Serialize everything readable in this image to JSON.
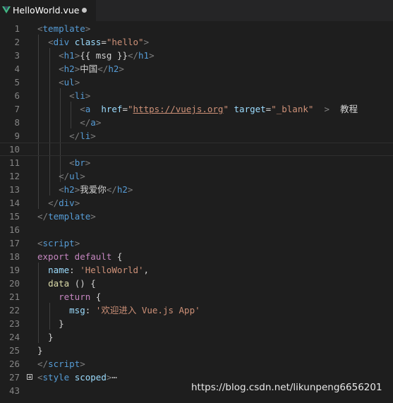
{
  "tab": {
    "title": "HelloWorld.vue",
    "unsaved": true
  },
  "line_numbers": [
    "1",
    "2",
    "3",
    "4",
    "5",
    "6",
    "7",
    "8",
    "9",
    "10",
    "11",
    "12",
    "13",
    "14",
    "15",
    "16",
    "17",
    "18",
    "19",
    "20",
    "21",
    "22",
    "23",
    "24",
    "25",
    "26",
    "27",
    "43"
  ],
  "code": {
    "l1_tag": "template",
    "l2_tag": "div",
    "l2_attr": "class",
    "l2_val": "\"hello\"",
    "l3_tag": "h1",
    "l3_text": "{{ msg }}",
    "l4_tag": "h2",
    "l4_text": "中国",
    "l5_tag": "ul",
    "l6_tag": "li",
    "l7_tag": "a",
    "l7_attr1": "href",
    "l7_val1": "https://vuejs.org",
    "l7_attr2": "target",
    "l7_val2": "\"_blank\"",
    "l7_text": "教程",
    "l8_tag": "a",
    "l9_tag": "li",
    "l11_tag": "br",
    "l12_tag": "ul",
    "l13_tag": "h2",
    "l13_text": "我爱你",
    "l14_tag": "div",
    "l15_tag": "template",
    "l17_tag": "script",
    "l18_kw": "export default",
    "l19_prop": "name",
    "l19_val": "'HelloWorld'",
    "l20_fn": "data",
    "l21_kw": "return",
    "l22_prop": "msg",
    "l22_val": "'欢迎进入 Vue.js App'",
    "l26_tag": "script",
    "l27_tag": "style",
    "l27_attr": "scoped",
    "l27_ellipsis": "⋯"
  },
  "watermark": "https://blog.csdn.net/likunpeng6656201",
  "colors": {
    "background": "#1e1e1e",
    "tag": "#569cd6",
    "attribute": "#9cdcfe",
    "string": "#ce9178",
    "keyword": "#c586c0",
    "function": "#dcdcaa",
    "line_number": "#858585"
  }
}
